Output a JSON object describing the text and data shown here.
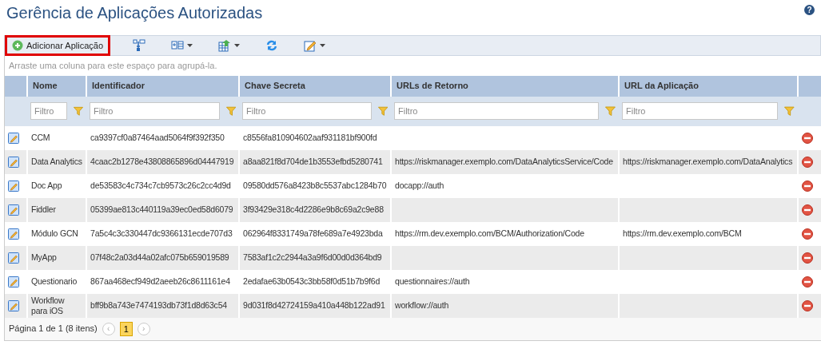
{
  "page": {
    "title": "Gerência de Aplicações Autorizadas",
    "help": "?"
  },
  "toolbar": {
    "add_button": {
      "label": "Adicionar Aplicação",
      "highlighted": true
    },
    "tools": [
      {
        "kind": "group",
        "dropdown": false
      },
      {
        "kind": "columns",
        "dropdown": true
      },
      {
        "kind": "export",
        "dropdown": true
      },
      {
        "kind": "refresh",
        "dropdown": false
      },
      {
        "kind": "edit",
        "dropdown": true
      }
    ]
  },
  "group_hint": "Arraste uma coluna para este espaço para agrupá-la.",
  "table": {
    "columns": [
      "Nome",
      "Identificador",
      "Chave Secreta",
      "URLs de Retorno",
      "URL da Aplicação"
    ],
    "filters": [
      {
        "placeholder": "Filtro"
      },
      {
        "placeholder": "Filtro"
      },
      {
        "placeholder": "Filtro"
      },
      {
        "placeholder": "Filtro"
      },
      {
        "placeholder": "Filtro"
      }
    ],
    "rows": [
      {
        "name": "CCM",
        "identifier": "ca9397cf0a87464aad5064f9f392f350",
        "secret": "c8556fa810904602aaf931181bf900fd",
        "return_urls": "",
        "app_url": ""
      },
      {
        "name": "Data Analytics",
        "identifier": "4caac2b1278e43808865896d04447919",
        "secret": "a8aa821f8d704de1b3553efbd5280741",
        "return_urls": "https://riskmanager.exemplo.com/DataAnalyticsService/Code",
        "app_url": "https://riskmanager.exemplo.com/DataAnalytics"
      },
      {
        "name": "Doc App",
        "identifier": "de53583c4c734c7cb9573c26c2cc4d9d",
        "secret": "09580dd576a8423b8c5537abc1284b70",
        "return_urls": "docapp://auth",
        "app_url": ""
      },
      {
        "name": "Fiddler",
        "identifier": "05399ae813c440119a39ec0ed58d6079",
        "secret": "3f93429e318c4d2286e9b8c69a2c9e88",
        "return_urls": "",
        "app_url": ""
      },
      {
        "name": "Módulo GCN",
        "identifier": "7a5c4c3c330447dc9366131ecde707d3",
        "secret": "062964f8331749a78fe689a7e4923bda",
        "return_urls": "https://rm.dev.exemplo.com/BCM/Authorization/Code",
        "app_url": "https://rm.dev.exemplo.com/BCM"
      },
      {
        "name": "MyApp",
        "identifier": "07f48c2a03d44a02afc075b659019589",
        "secret": "7583af1c2c2944a3a9f6d00d0d364bd9",
        "return_urls": "",
        "app_url": ""
      },
      {
        "name": "Questionario",
        "identifier": "867aa468ecf949d2aeeb26c8611161e4",
        "secret": "2edafae63b0543c3bb58f0d51b7b9f6d",
        "return_urls": "questionnaires://auth",
        "app_url": ""
      },
      {
        "name": "Workflow para iOS",
        "identifier": "bff9b8a743e7474193db73f1d8d63c54",
        "secret": "9d031f8d42724159a410a448b122ad91",
        "return_urls": "workflow://auth",
        "app_url": ""
      }
    ]
  },
  "pager": {
    "summary": "Página 1 de 1 (8 itens)",
    "prev": "‹",
    "next": "›",
    "pages": [
      {
        "label": "1",
        "selected": true
      }
    ]
  }
}
